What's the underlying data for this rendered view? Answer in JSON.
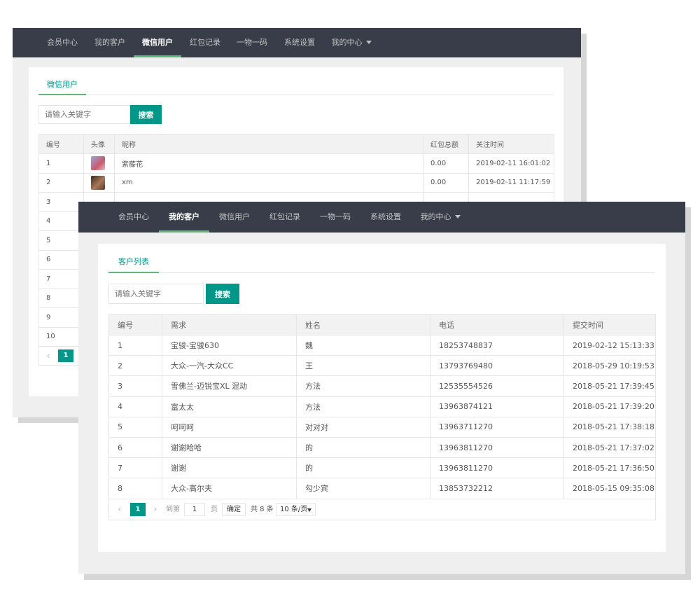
{
  "back_window": {
    "nav": [
      {
        "label": "会员中心"
      },
      {
        "label": "我的客户"
      },
      {
        "label": "微信用户"
      },
      {
        "label": "红包记录"
      },
      {
        "label": "一物一码"
      },
      {
        "label": "系统设置"
      },
      {
        "label": "我的中心"
      }
    ],
    "active_nav": "微信用户",
    "tab": "微信用户",
    "search": {
      "placeholder": "请输入关键字",
      "button": "搜索"
    },
    "table": {
      "headers": [
        "编号",
        "头像",
        "昵称",
        "红包总额",
        "关注时间"
      ],
      "rows": [
        {
          "id": "1",
          "nickname": "紫藤花",
          "amount": "0.00",
          "time": "2019-02-11 16:01:02"
        },
        {
          "id": "2",
          "nickname": "xm",
          "amount": "0.00",
          "time": "2019-02-11 11:17:59"
        },
        {
          "id": "3",
          "nickname": "",
          "amount": "",
          "time": ""
        },
        {
          "id": "4"
        },
        {
          "id": "5"
        },
        {
          "id": "6"
        },
        {
          "id": "7"
        },
        {
          "id": "8"
        },
        {
          "id": "9"
        },
        {
          "id": "10"
        }
      ]
    },
    "pager": {
      "page": "1"
    }
  },
  "front_window": {
    "nav": [
      {
        "label": "会员中心"
      },
      {
        "label": "我的客户"
      },
      {
        "label": "微信用户"
      },
      {
        "label": "红包记录"
      },
      {
        "label": "一物一码"
      },
      {
        "label": "系统设置"
      },
      {
        "label": "我的中心"
      }
    ],
    "active_nav": "我的客户",
    "tab": "客户列表",
    "search": {
      "placeholder": "请输入关键字",
      "button": "搜索"
    },
    "table": {
      "headers": [
        "编号",
        "需求",
        "姓名",
        "电话",
        "提交时间"
      ],
      "rows": [
        {
          "id": "1",
          "need": "宝骏-宝骏630",
          "name": "魏",
          "phone": "18253748837",
          "time": "2019-02-12 15:13:33"
        },
        {
          "id": "2",
          "need": "大众-一汽-大众CC",
          "name": "王",
          "phone": "13793769480",
          "time": "2018-05-29 10:19:53"
        },
        {
          "id": "3",
          "need": "雪佛兰-迈锐宝XL 混动",
          "name": "方法",
          "phone": "12535554526",
          "time": "2018-05-21 17:39:45"
        },
        {
          "id": "4",
          "need": "富太太",
          "name": "方法",
          "phone": "13963874121",
          "time": "2018-05-21 17:39:20"
        },
        {
          "id": "5",
          "need": "呵呵呵",
          "name": "对对对",
          "phone": "13963711270",
          "time": "2018-05-21 17:38:18"
        },
        {
          "id": "6",
          "need": "谢谢哈哈",
          "name": "的",
          "phone": "13963811270",
          "time": "2018-05-21 17:37:02"
        },
        {
          "id": "7",
          "need": "谢谢",
          "name": "的",
          "phone": "13963811270",
          "time": "2018-05-21 17:36:50"
        },
        {
          "id": "8",
          "need": "大众-高尔夫",
          "name": "勾少宾",
          "phone": "13853732212",
          "time": "2018-05-15 09:35:08"
        }
      ]
    },
    "pager": {
      "page": "1",
      "goto_label": "到第",
      "goto_value": "1",
      "page_unit": "页",
      "confirm": "确定",
      "total": "共 8 条",
      "page_size": "10 条/页"
    }
  },
  "colors": {
    "nav_bg": "#393d49",
    "accent": "#009688",
    "active_underline": "#5fb878"
  }
}
